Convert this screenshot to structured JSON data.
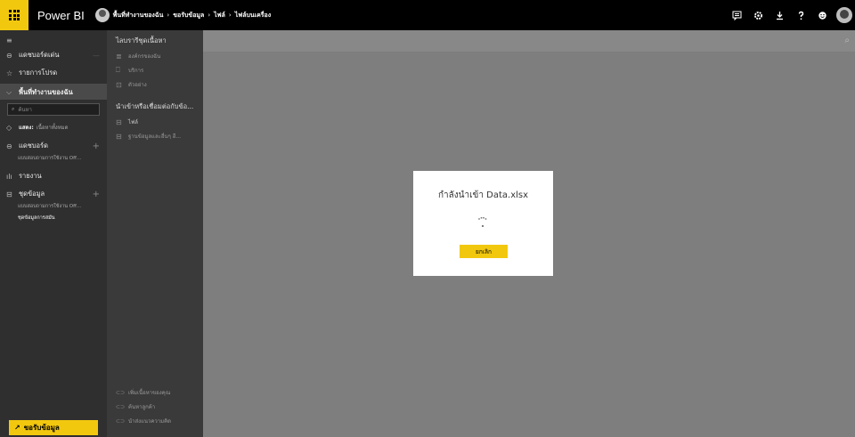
{
  "topbar": {
    "app_name": "Power BI",
    "breadcrumbs": [
      "พื้นที่ทำงานของฉัน",
      "ขอรับข้อมูล",
      "ไฟล์",
      "ไฟล์บนเครื่อง"
    ],
    "icons": [
      "apps-icon",
      "feedback-icon",
      "settings-icon",
      "download-icon",
      "help-icon",
      "smiley-icon",
      "user-avatar"
    ]
  },
  "leftnav": {
    "menu_icon": "≡",
    "favorites": "แดชบอร์ดเด่น",
    "favorites_glyph": "⊖",
    "favorites_line": "—",
    "reports_fav": "รายการโปรด",
    "star_glyph": "☆",
    "workspace": "พื้นที่ทำงานของฉัน",
    "chevron_glyph": "⌵",
    "search_placeholder": "ค้นหา",
    "search_glyph": "⌕",
    "show_label": "แสดง:",
    "show_value": "เนื้อหาทั้งหมด",
    "eye_glyph": "◇",
    "dashboards": "แดชบอร์ด",
    "dashboard_glyph": "⊖",
    "plus_glyph": "+",
    "dashboards_sub": "แบบสอบถามการใช้งาน Off...",
    "reports": "รายงาน",
    "report_glyph": "ılı",
    "datasets": "ชุดข้อมูล",
    "dataset_glyph": "⊟",
    "datasets_sub1": "แบบสอบถามการใช้งาน Off...",
    "datasets_sub2": "ชุดข้อมูลการสมัน",
    "get_data": "ขอรับข้อมูล",
    "arrow_glyph": "↗"
  },
  "panel": {
    "library_header": "ไลบรารีชุดเนื้อหา",
    "items_top": [
      {
        "icon": "≣",
        "label": "องค์กรของฉัน"
      },
      {
        "icon": "⎕",
        "label": "บริการ"
      },
      {
        "icon": "⊡",
        "label": "ตัวอย่าง"
      }
    ],
    "import_header": "นำเข้าหรือเชื่อมต่อกับข้อ...",
    "items_import": [
      {
        "icon": "⊟",
        "label": "ไฟล์"
      },
      {
        "icon": "⊟",
        "label": "ฐานข้อมูลและอื่นๆ อี..."
      }
    ],
    "items_bottom": [
      {
        "icon": "⊂⊃",
        "label": "เพิ่มเนื้อหาของคุณ"
      },
      {
        "icon": "⊂⊃",
        "label": "ค้นหาลูกค้า"
      },
      {
        "icon": "⊂⊃",
        "label": "นำส่งแนวความคิด"
      }
    ]
  },
  "main": {
    "search_glyph": "⌕"
  },
  "dialog": {
    "title": "กำลังนำเข้า Data.xlsx",
    "cancel_label": "ยกเลิก"
  }
}
